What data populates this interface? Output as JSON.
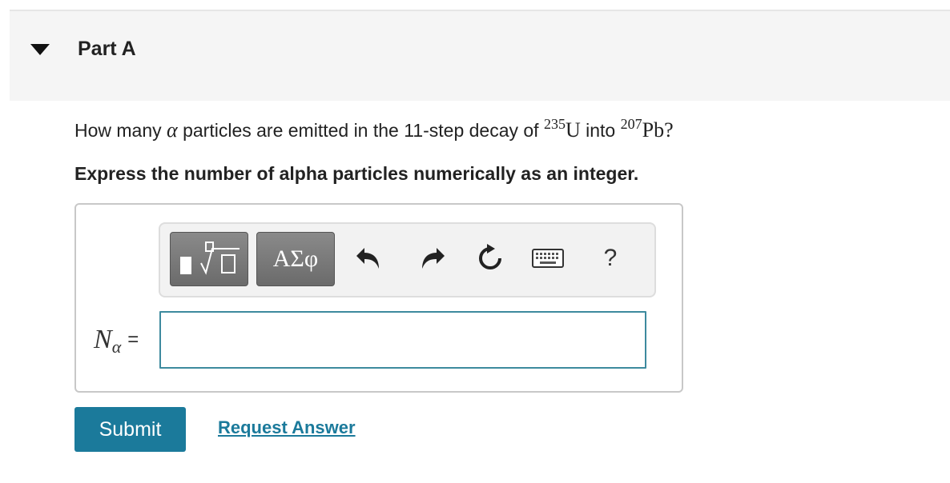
{
  "part": {
    "title": "Part A"
  },
  "question": {
    "prefix": "How many",
    "alpha_symbol": "α",
    "middle": "particles are emitted in the 11-step decay of",
    "mass_u": "235",
    "element_u": "U",
    "into": "into",
    "mass_pb": "207",
    "element_pb": "Pb",
    "end": "?"
  },
  "instruction": "Express the number of alpha particles numerically as an integer.",
  "toolbar": {
    "symbols_label": "ΑΣφ",
    "help_label": "?",
    "icons": [
      "templates-icon",
      "undo-icon",
      "redo-icon",
      "reset-icon",
      "keyboard-icon",
      "help-icon"
    ]
  },
  "answer": {
    "variable": "N",
    "subscript": "α",
    "equals": "=",
    "value": "",
    "placeholder": ""
  },
  "actions": {
    "submit_label": "Submit",
    "request_label": "Request Answer"
  },
  "colors": {
    "accent": "#1b7a9b",
    "input_border": "#3d8a9e",
    "header_bg": "#f5f5f5"
  }
}
